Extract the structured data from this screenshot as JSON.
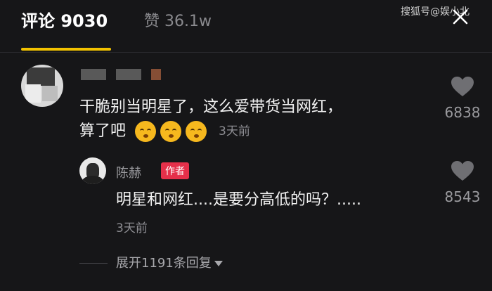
{
  "header": {
    "comments_tab": "评论 9030",
    "likes_tab": "赞 36.1w",
    "watermark": "搜狐号@娱小北"
  },
  "comment": {
    "text_line1": "干脆别当明星了，这么爱带货当网红，",
    "text_line2": "算了吧",
    "emojis": [
      "sleepy-emoji",
      "sleepy-emoji",
      "sleepy-emoji"
    ],
    "time": "3天前",
    "likes": "6838"
  },
  "reply": {
    "author": "陈赫",
    "badge": "作者",
    "text": "明星和网红....是要分高低的吗？.....",
    "time": "3天前",
    "likes": "8543"
  },
  "expand": {
    "label": "展开1191条回复"
  },
  "colors": {
    "background": "#161618",
    "accent": "#f2c200",
    "author_badge": "#e5304a"
  }
}
